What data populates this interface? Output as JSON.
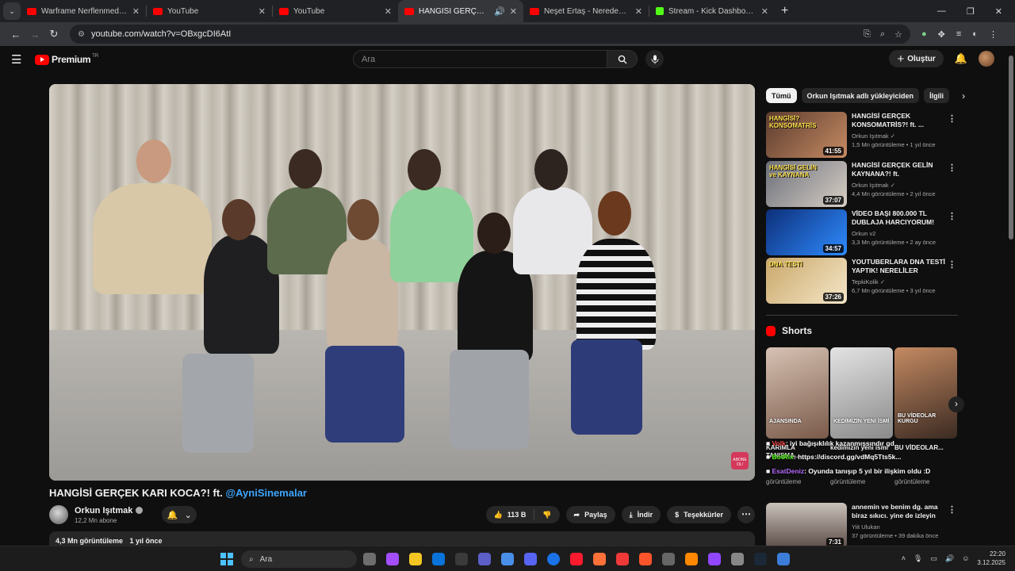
{
  "browser": {
    "tabs": [
      {
        "title": "Warframe Nerflenmeden O",
        "favicon": "youtube",
        "active": false
      },
      {
        "title": "YouTube",
        "favicon": "youtube",
        "active": false
      },
      {
        "title": "YouTube",
        "favicon": "youtube",
        "active": false
      },
      {
        "title": "HANGİSİ GERÇEK KARI KOC",
        "favicon": "youtube",
        "active": true
      },
      {
        "title": "Neşet Ertaş - Neredesin Sen (Je",
        "favicon": "youtube",
        "active": false
      },
      {
        "title": "Stream - Kick Dashboard",
        "favicon": "kick",
        "active": false
      }
    ],
    "url": "youtube.com/watch?v=OBxgcDI6AtI"
  },
  "masthead": {
    "logo_text": "Premium",
    "logo_tm": "TR",
    "search_placeholder": "Ara",
    "create_label": "Oluştur"
  },
  "video": {
    "title": "HANGİSİ GERÇEK KARI KOCA?! ft.",
    "title_mention": "@AyniSinemalar",
    "watermark": "ABONE OL!",
    "channel": {
      "name": "Orkun Işıtmak",
      "subscribers": "12,2 Mn abone"
    },
    "likes": "113 B",
    "share_label": "Paylaş",
    "download_label": "İndir",
    "thanks_label": "Teşekkürler",
    "views": "4,3 Mn görüntüleme",
    "age": "1 yıl önce"
  },
  "sidebar": {
    "chips": [
      "Tümü",
      "Orkun Işıtmak adlı yükleyiciden",
      "İlgili"
    ],
    "recommendations": [
      {
        "title": "HANGİSİ GERÇEK KONSOMATRİS?! ft. ...",
        "channel": "Orkun Işıtmak",
        "verified": true,
        "views": "1,5 Mn görüntüleme",
        "age": "1 yıl önce",
        "duration": "41:55",
        "thumb_text": "HANGİSİ? KONSOMATRİS",
        "thumb_colors": [
          "#5a3b2e",
          "#c78b63"
        ]
      },
      {
        "title": "HANGİSİ GERÇEK GELİN KAYNANA?! ft. @AyniSinemalar",
        "channel": "Orkun Işıtmak",
        "verified": true,
        "views": "4,4 Mn görüntüleme",
        "age": "2 yıl önce",
        "duration": "37:07",
        "thumb_text": "HANGİSİ GELİN ve KAYNANA",
        "thumb_colors": [
          "#6b6f7a",
          "#d8cfc5"
        ]
      },
      {
        "title": "VİDEO BAŞI 800.000 TL DUBLAJA HARCIYORUM! Ruhi...",
        "channel": "Orkun v2",
        "verified": false,
        "views": "3,3 Mn görüntüleme",
        "age": "2 ay önce",
        "duration": "34:57",
        "thumb_text": "",
        "thumb_colors": [
          "#0d2f7a",
          "#2e8bff"
        ]
      },
      {
        "title": "YOUTUBERLARA DNA TESTİ YAPTIK! NERELİLER ÖĞRENDİK!",
        "channel": "TepkiKolik",
        "verified": true,
        "views": "6,7 Mn görüntüleme",
        "age": "3 yıl önce",
        "duration": "37:26",
        "thumb_text": "DNA TESTİ",
        "thumb_colors": [
          "#c9a86a",
          "#f5e6c8"
        ]
      }
    ],
    "shorts_heading": "Shorts",
    "shorts": [
      {
        "caption": "AJANSINDA",
        "title": "KARIMLA TANIŞMA...",
        "views": "görüntüleme",
        "colors": [
          "#7a5a4a",
          "#d7c2b3"
        ]
      },
      {
        "caption": "KEDİMİZİN YENİ İSMİ",
        "title": "kedimizin yeni ismi",
        "views": "görüntüleme",
        "colors": [
          "#8a8a8a",
          "#e3e3e3"
        ]
      },
      {
        "caption": "BU VİDEOLAR KURGU",
        "title": "BU VİDEOLAR...",
        "views": "görüntüleme",
        "colors": [
          "#3b2a22",
          "#c48a62"
        ]
      }
    ],
    "chat": [
      {
        "user": "Volk",
        "text": ": iyi bağışıklılık kazanmışsındır gd"
      },
      {
        "user": "BotRix",
        "text": ": https://discord.gg/vdMq5Tts5k..."
      },
      {
        "user": "EsatDeniz",
        "text": ": Oyunda tanışıp 5 yıl bir ilişkim oldu :D"
      }
    ],
    "bottom_rec": {
      "title": "annemin ve benim dg. ama biraz sıkıcı. yine de izleyin",
      "channel": "Yiit Ulukan",
      "views": "37 görüntüleme",
      "age": "39 dakika önce",
      "duration": "7:31",
      "thumb_colors": [
        "#c9c2bb",
        "#5a4a44"
      ]
    }
  },
  "taskbar": {
    "search_placeholder": "Ara",
    "time": "22:20",
    "date": "3.12.2025",
    "apps": [
      "file-explorer",
      "copilot",
      "folder",
      "mail",
      "calculator",
      "teams",
      "notepad",
      "discord",
      "chrome",
      "opera",
      "firefox",
      "vivaldi",
      "brave",
      "obs",
      "vlc",
      "twitch",
      "terminal",
      "steam",
      "mixer"
    ],
    "app_colors": [
      "#6e6e6e",
      "#a34dff",
      "#f3c623",
      "#0a74da",
      "#3a3a3a",
      "#5b5fc7",
      "#4a8fe7",
      "#5865f2",
      "#1a73e8",
      "#ff1b2d",
      "#ff7139",
      "#ef3939",
      "#fb542b",
      "#666666",
      "#ff8800",
      "#9146ff",
      "#888888",
      "#1b2838",
      "#3c7dd9"
    ]
  },
  "colors": {
    "youtube_red": "#ff0000",
    "link_blue": "#3ea6ff",
    "kick_green": "#53fc18"
  }
}
